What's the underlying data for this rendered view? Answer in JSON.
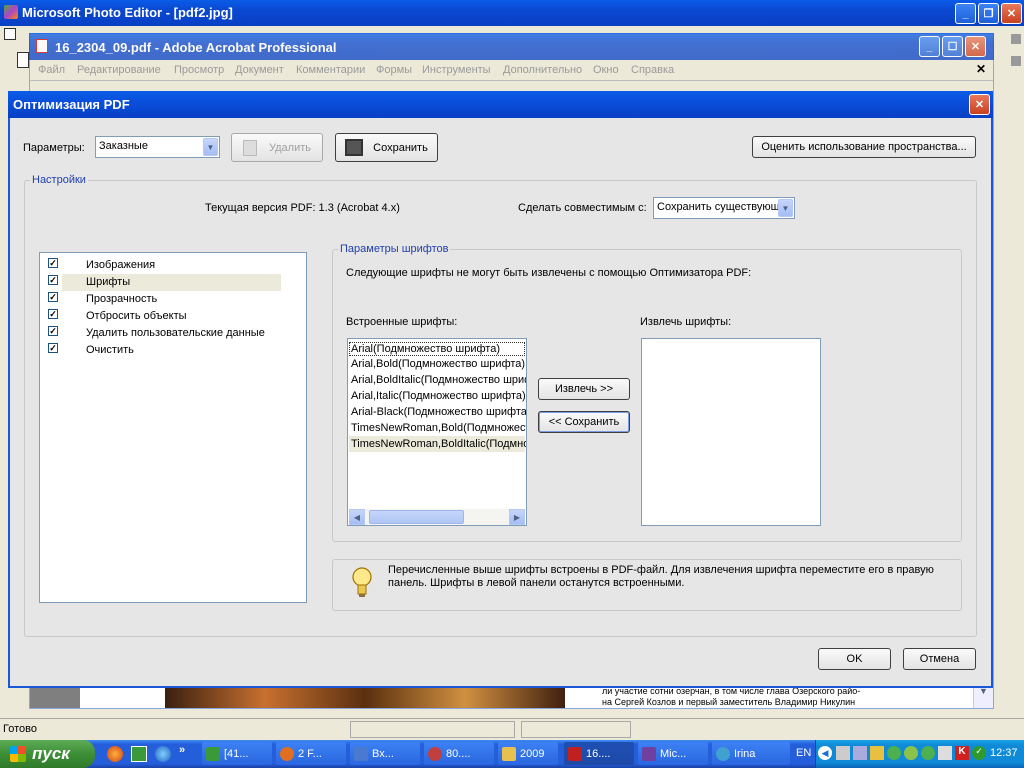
{
  "photo_editor": {
    "title": "Microsoft Photo Editor - [pdf2.jpg]"
  },
  "acrobat": {
    "title": "16_2304_09.pdf - Adobe Acrobat Professional",
    "menu": [
      "Файл",
      "Редактирование",
      "Просмотр",
      "Документ",
      "Комментарии",
      "Формы",
      "Инструменты",
      "Дополнительно",
      "Окно",
      "Справка"
    ]
  },
  "dialog": {
    "title": "Оптимизация PDF",
    "params_label": "Параметры:",
    "params_value": "Заказные",
    "delete_label": "Удалить",
    "save_label": "Сохранить",
    "estimate_label": "Оценить использование пространства...",
    "settings_group": "Настройки",
    "current_version": "Текущая версия PDF: 1.3 (Acrobat 4.x)",
    "compat_label": "Сделать совместимым с:",
    "compat_value": "Сохранить существующие",
    "panels": [
      {
        "label": "Изображения",
        "checked": true
      },
      {
        "label": "Шрифты",
        "checked": true
      },
      {
        "label": "Прозрачность",
        "checked": true
      },
      {
        "label": "Отбросить объекты",
        "checked": true
      },
      {
        "label": "Удалить пользовательские данные",
        "checked": true
      },
      {
        "label": "Очистить",
        "checked": true
      }
    ],
    "fonts_group": "Параметры шрифтов",
    "fonts_note": "Следующие шрифты не могут быть извлечены с помощью Оптимизатора PDF:",
    "embedded_label": "Встроенные шрифты:",
    "embedded_fonts": [
      "Arial(Подмножество шрифта)",
      "Arial,Bold(Подмножество шрифта)",
      "Arial,BoldItalic(Подмножество шрифта)",
      "Arial,Italic(Подмножество шрифта)",
      "Arial-Black(Подмножество шрифта)",
      "TimesNewRoman,Bold(Подмножество шрифта)",
      "TimesNewRoman,BoldItalic(Подмножество шрифта)"
    ],
    "extract_btn": "Извлечь >>",
    "keep_btn": "<< Сохранить",
    "extract_label": "Извлечь шрифты:",
    "tip": "Перечисленные выше шрифты встроены в PDF-файл. Для извлечения шрифта переместите его в правую панель. Шрифты в левой панели останутся встроенными.",
    "ok": "OK",
    "cancel": "Отмена"
  },
  "background_text": {
    "line1": "ли участие сотни озерчан, в том числе глава Озерского райо-",
    "line2": "на Сергей Козлов и первый заместитель Владимир Никулин"
  },
  "status": {
    "text": "Готово"
  },
  "taskbar": {
    "start": "пуск",
    "items": [
      {
        "label": "[41...",
        "color": "#3a9a3a"
      },
      {
        "label": "2 F...",
        "color": "#e07020"
      },
      {
        "label": "Вх...",
        "color": "#4a7ad0"
      },
      {
        "label": "80....",
        "color": "#c04040"
      },
      {
        "label": "2009",
        "color": "#e8c050"
      },
      {
        "label": "16....",
        "color": "#c02020"
      },
      {
        "label": "Mic...",
        "color": "#7040a0"
      },
      {
        "label": "Irina",
        "color": "#40a0d0"
      }
    ],
    "lang": "EN",
    "clock": "12:37"
  }
}
